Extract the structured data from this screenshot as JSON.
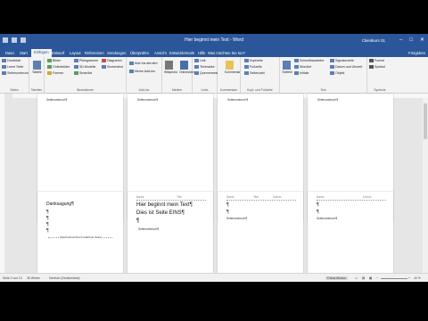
{
  "window": {
    "title": "Hier beginnt mein Text - Word",
    "user": "Clientkurs 01",
    "minimize": "–",
    "maximize": "□",
    "close": "✕"
  },
  "tabs": [
    "Datei",
    "Start",
    "Einfügen",
    "Entwurf",
    "Layout",
    "Referenzen",
    "Sendungen",
    "Überprüfen",
    "Ansicht",
    "Entwicklertools",
    "Hilfe",
    "Was möchten Sie tun?"
  ],
  "share": "Freigeben",
  "ribbon": {
    "seiten": {
      "deckblatt": "Deckblatt",
      "leere_seite": "Leere Seite",
      "seitenumbruch": "Seitenumbruch",
      "label": "Seiten"
    },
    "tabelle": {
      "btn": "Tabelle",
      "label": "Tabellen"
    },
    "illustrationen": {
      "bilder": "Bilder",
      "onlinebilder": "Onlinebilder",
      "formen": "Formen",
      "piktogramme": "Piktogramme",
      "3d": "3D-Modelle",
      "smartart": "SmartArt",
      "diagramm": "Diagramm",
      "screenshot": "Screenshot",
      "label": "Illustrationen"
    },
    "addins": {
      "add": "Add-Ins abrufen",
      "meine": "Meine Add-Ins",
      "label": "Add-Ins"
    },
    "medien": {
      "wikipedia": "Wikipedia",
      "onlinevideos": "Onlinevideos",
      "label": "Medien"
    },
    "links": {
      "link": "Link",
      "textmarke": "Textmarke",
      "querverweis": "Querverweis",
      "label": "Links"
    },
    "kommentare": {
      "btn": "Kommentar",
      "label": "Kommentare"
    },
    "kopf": {
      "kopfzeile": "Kopfzeile",
      "fusszeile": "Fußzeile",
      "seitenzahl": "Seitenzahl",
      "label": "Kopf- und Fußzeile"
    },
    "text": {
      "textfeld": "Textfeld",
      "schnellbausteine": "Schnellbausteine",
      "wordart": "WordArt",
      "initiale": "Initiale",
      "signatur": "Signaturzeile",
      "datum": "Datum und Uhrzeit",
      "objekt": "Objekt",
      "label": "Text"
    },
    "symbole": {
      "formel": "Formel",
      "symbol": "Symbol",
      "label": "Symbole"
    }
  },
  "pages_top": [
    {
      "footer": "Seitenumbruch¶"
    },
    {
      "footer": "Seitenumbruch¶"
    },
    {
      "footer": "Seitenumbruch¶"
    },
    {
      "footer": "Seitenumbruch¶"
    }
  ],
  "pages_bottom": [
    {
      "heading": "Danksagung¶",
      "pilcrows": [
        "¶",
        "¶",
        "¶",
        "¶"
      ],
      "section_break": "Abschnittsumbruch (Nächste Seite)"
    },
    {
      "header_left": "Name",
      "header_mid": "Titel",
      "lines": [
        "Hier beginnt mein Text¶",
        "Dies ist Seite EINS¶",
        "¶"
      ],
      "footer": "Seitenumbruch¶"
    },
    {
      "header_left": "Name",
      "header_mid": "Titel",
      "header_right": "Datum",
      "lines": [
        "¶",
        "¶"
      ],
      "footer": "Seitenumbruch¶"
    },
    {
      "header_left": "Name",
      "header_right": "Datum",
      "lines": [
        "¶",
        "¶"
      ],
      "footer": "Seitenumbruch¶"
    }
  ],
  "status": {
    "page": "Seite 2 von 13",
    "words": "35 Wörter",
    "language": "Deutsch (Deutschland)",
    "focus": "Fokus-Modus",
    "zoom": "40 %"
  }
}
